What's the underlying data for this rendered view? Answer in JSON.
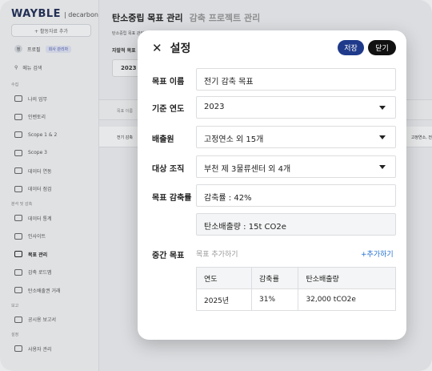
{
  "sidebar": {
    "logo_main": "WAYBLE",
    "logo_sub": "| decarbon",
    "add_button": "+ 활동자료 추가",
    "profile_initial": "정",
    "profile_name": "프로필",
    "profile_role": "회사 관리자",
    "menu_search": "메뉴 검색",
    "sections": [
      {
        "title": "수집",
        "items": [
          "나의 업무",
          "인벤토리",
          "Scope 1 & 2",
          "Scope 3",
          "데이터 연동",
          "데이터 점검"
        ]
      },
      {
        "title": "분석 및 감축",
        "items": [
          "데이터 통계",
          "인사이트",
          "목표 관리",
          "감축 로드맵",
          "탄소배출권 거래"
        ]
      },
      {
        "title": "보고",
        "items": [
          "공시용 보고서"
        ]
      },
      {
        "title": "설정",
        "items": [
          "사용자 관리"
        ]
      }
    ],
    "active_item": "목표 관리"
  },
  "main": {
    "title": "탄소중립 목표 관리",
    "title_muted": "감축 프로젝트 관리",
    "breadcrumb": "탄소중립 목표 관리",
    "self_set_label": "자발적 목표",
    "year": "2023",
    "table_head": "목표 이름",
    "table_row": "전기 감축",
    "table_row_right": "고정연소, 전"
  },
  "modal": {
    "title": "설정",
    "save_label": "저장",
    "close_label": "닫기",
    "fields": {
      "goal_name_label": "목표 이름",
      "goal_name_value": "전기 감축 목표",
      "base_year_label": "기준 연도",
      "base_year_value": "2023",
      "emission_source_label": "배출원",
      "emission_source_value": "고정연소 외 15개",
      "target_org_label": "대상 조직",
      "target_org_value": "부천 제 3물류센터 외 4개",
      "reduction_label": "목표 감축률",
      "reduction_rate_value": "감축률 : 42%",
      "emission_value": "탄소배출량 : 15t CO2e"
    },
    "midterm": {
      "label": "중간 목표",
      "placeholder": "목표 추가하기",
      "add_link": "+추가하기",
      "columns": [
        "연도",
        "감축률",
        "탄소배출량"
      ],
      "rows": [
        [
          "2025년",
          "31%",
          "32,000 tCO2e"
        ]
      ]
    },
    "colors": {
      "save": "#1f3a8a",
      "close": "#111111",
      "link": "#1f6fd1"
    }
  }
}
